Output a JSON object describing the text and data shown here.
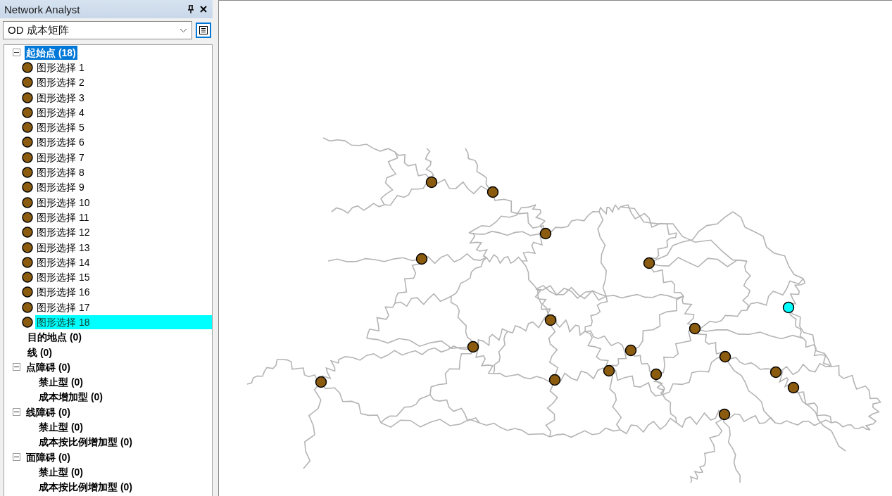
{
  "panel": {
    "title": "Network Analyst"
  },
  "analysis_select": {
    "value": "OD 成本矩阵"
  },
  "tree": [
    {
      "kind": "group",
      "label": "起始点 (18)",
      "selected": true,
      "expanded": true,
      "children": [
        {
          "kind": "stop",
          "label": "图形选择 1",
          "selected": false
        },
        {
          "kind": "stop",
          "label": "图形选择 2",
          "selected": false
        },
        {
          "kind": "stop",
          "label": "图形选择 3",
          "selected": false
        },
        {
          "kind": "stop",
          "label": "图形选择 4",
          "selected": false
        },
        {
          "kind": "stop",
          "label": "图形选择 5",
          "selected": false
        },
        {
          "kind": "stop",
          "label": "图形选择 6",
          "selected": false
        },
        {
          "kind": "stop",
          "label": "图形选择 7",
          "selected": false
        },
        {
          "kind": "stop",
          "label": "图形选择 8",
          "selected": false
        },
        {
          "kind": "stop",
          "label": "图形选择 9",
          "selected": false
        },
        {
          "kind": "stop",
          "label": "图形选择 10",
          "selected": false
        },
        {
          "kind": "stop",
          "label": "图形选择 11",
          "selected": false
        },
        {
          "kind": "stop",
          "label": "图形选择 12",
          "selected": false
        },
        {
          "kind": "stop",
          "label": "图形选择 13",
          "selected": false
        },
        {
          "kind": "stop",
          "label": "图形选择 14",
          "selected": false
        },
        {
          "kind": "stop",
          "label": "图形选择 15",
          "selected": false
        },
        {
          "kind": "stop",
          "label": "图形选择 16",
          "selected": false
        },
        {
          "kind": "stop",
          "label": "图形选择 17",
          "selected": false
        },
        {
          "kind": "stop",
          "label": "图形选择 18",
          "selected": true
        }
      ]
    },
    {
      "kind": "group",
      "label": "目的地点 (0)",
      "selected": false
    },
    {
      "kind": "group",
      "label": "线 (0)",
      "selected": false
    },
    {
      "kind": "group",
      "label": "点障碍 (0)",
      "selected": false,
      "expanded": true,
      "children": [
        {
          "kind": "subclass",
          "label": "禁止型 (0)",
          "selected": false
        },
        {
          "kind": "subclass",
          "label": "成本增加型 (0)",
          "selected": false
        }
      ]
    },
    {
      "kind": "group",
      "label": "线障碍 (0)",
      "selected": false,
      "expanded": true,
      "children": [
        {
          "kind": "subclass",
          "label": "禁止型 (0)",
          "selected": false
        },
        {
          "kind": "subclass",
          "label": "成本按比例增加型 (0)",
          "selected": false
        }
      ]
    },
    {
      "kind": "group",
      "label": "面障碍 (0)",
      "selected": false,
      "expanded": true,
      "children": [
        {
          "kind": "subclass",
          "label": "禁止型 (0)",
          "selected": false
        },
        {
          "kind": "subclass",
          "label": "成本按比例增加型 (0)",
          "selected": false
        }
      ]
    }
  ]
}
